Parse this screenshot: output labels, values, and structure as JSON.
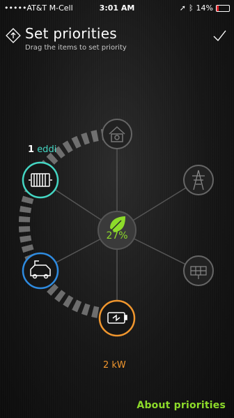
{
  "status_bar": {
    "carrier": "•••••AT&T M-Cell",
    "time": "3:01 AM",
    "battery_percent": "14%",
    "battery_level": 0.14
  },
  "header": {
    "title": "Set priorities",
    "subtitle": "Drag the items to set priority"
  },
  "diagram": {
    "heating": {
      "rank": "1",
      "name": "eddi"
    },
    "core_percent": "27%",
    "battery_power": "2 kW",
    "colors": {
      "teal": "#44d6c3",
      "blue": "#2e8be0",
      "orange": "#f0962e",
      "green": "#8ddb2a",
      "inactive": "#6b6b6b"
    },
    "icons": [
      "house-icon",
      "heater-icon",
      "grid-pylon-icon",
      "leaf-icon",
      "ev-car-icon",
      "solar-panel-icon",
      "battery-icon"
    ]
  },
  "footer": {
    "about_link": "About priorities"
  }
}
